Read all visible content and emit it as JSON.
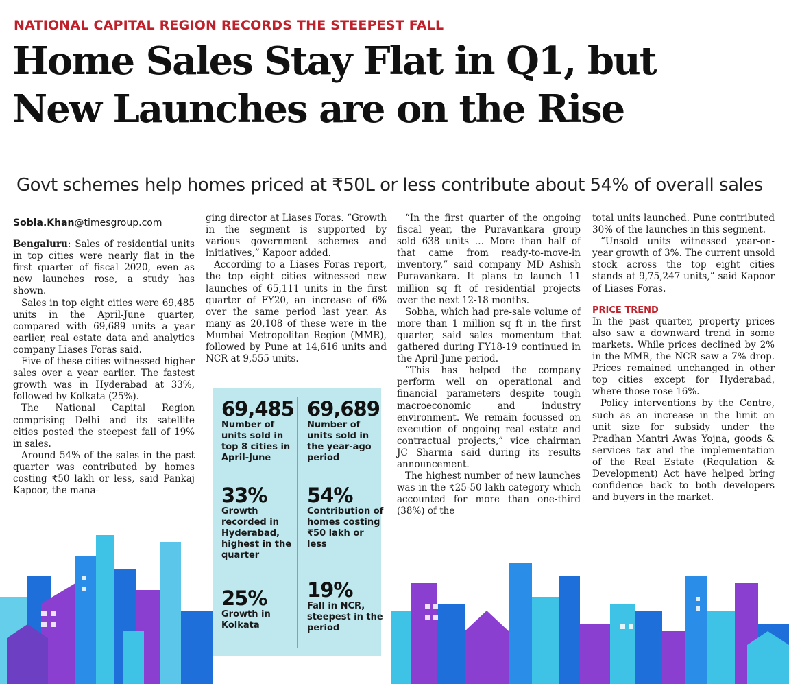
{
  "kicker": "NATIONAL CAPITAL REGION RECORDS THE STEEPEST FALL",
  "headline": {
    "line1": "Home Sales Stay Flat in Q1, but",
    "line2": "New Launches are on the Rise"
  },
  "deck": "Govt schemes help homes priced at ₹50L or less contribute about 54% of overall sales",
  "byline": {
    "name": "Sobia.Khan",
    "domain": "@timesgroup.com"
  },
  "col1": {
    "dateline": "Bengaluru",
    "p1": ": Sales of residential units in top cities were nearly flat in the first quarter of fiscal 2020, even as new launches rose, a study has shown.",
    "p2": "Sales in top eight cities were 69,485 units in the April-June quarter, compared with 69,689 units a year earlier, real estate data and analytics company Liases Foras said.",
    "p3": "Five of these cities witnessed higher sales over a year earlier. The fastest growth was in Hyderabad at 33%, followed by Kolkata (25%).",
    "p4": "The National Capital Region comprising Delhi and its satellite cities posted the steepest fall of 19% in sales.",
    "p5": "Around 54% of the sales in the past quarter was contributed by homes costing ₹50 lakh or less, said Pankaj Kapoor, the mana-"
  },
  "col2": {
    "p1": "ging director at Liases Foras. “Growth in the segment is supported by various government schemes and initiatives,” Kapoor added.",
    "p2": "According to a Liases Foras report, the top eight cities witnessed new launches of 65,111 units in the first quarter of FY20, an increase of 6% over the same period last year. As many as 20,108 of these were in the Mumbai Metropolitan Region (MMR), followed by Pune at 14,616 units and NCR at 9,555 units."
  },
  "stats": [
    {
      "num": "69,485",
      "desc": "Number of units sold in top 8 cities in April-June"
    },
    {
      "num": "69,689",
      "desc": "Number of units sold in the year-ago period"
    },
    {
      "num": "33%",
      "desc": "Growth recorded in Hyderabad, highest in the quarter"
    },
    {
      "num": "54%",
      "desc": "Contribution of homes costing ₹50 lakh or less"
    },
    {
      "num": "25%",
      "desc": "Growth in Kolkata"
    },
    {
      "num": "19%",
      "desc": "Fall in NCR, steepest in the period"
    }
  ],
  "col3": {
    "p1": "“In the first quarter of the ongoing fiscal year, the Puravankara group sold 638 units … More than half of that came from ready-to-move-in inventory,” said company MD Ashish Puravankara. It plans to launch 11 million sq ft of residential projects over the next 12-18 months.",
    "p2": "Sobha, which had pre-sale volume of more than 1 million sq ft in the first quarter, said sales momentum that gathered during FY18-19 continued in the April-June period.",
    "p3": "“This has helped the company perform well on operational and financial parameters despite tough macroeconomic and industry environment. We remain focussed on execution of ongoing real estate and contractual projects,” vice chairman JC Sharma said during its results announcement.",
    "p4": "The highest number of new launches was in the ₹25-50 lakh category which accounted for more than one-third (38%) of the"
  },
  "col4": {
    "p1": "total units launched. Pune contributed 30% of the launches in this segment.",
    "p2": "“Unsold units witnessed year-on-year growth of 3%. The current unsold stock across the top eight cities stands at 9,75,247 units,” said Kapoor of Liases Foras.",
    "section": "PRICE TREND",
    "p3": "In the past quarter, property prices also saw a downward trend in some markets. While prices declined by 2% in the MMR, the NCR saw a 7% drop. Prices remained unchanged in other top cities except for Hyderabad, where those rose 16%.",
    "p4": "Policy interventions by the Centre, such as an increase in the limit on unit size for subsidy under the Pradhan Mantri Awas Yojna, goods & services tax and the implementation of the Real Estate (Regulation & Development) Act have helped bring confidence back to both developers and buyers in the market."
  },
  "colors": {
    "kicker": "#c0202a",
    "panel": "#bfe8ee",
    "skyline_blue": "#1e6fd9",
    "skyline_purple": "#8a3fd1",
    "skyline_cyan": "#3ec3e6"
  }
}
